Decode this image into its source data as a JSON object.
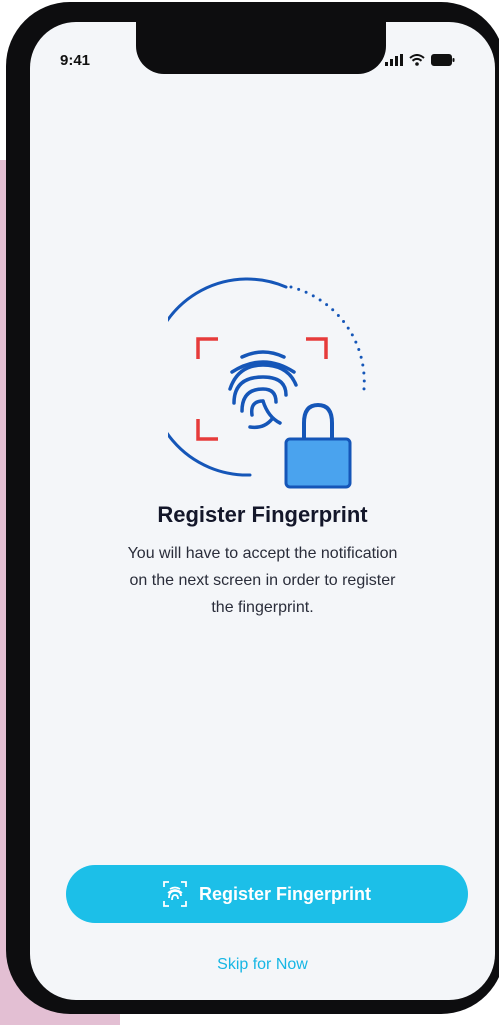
{
  "status_bar": {
    "time": "9:41",
    "signal_icon": "signal-bars-icon",
    "wifi_icon": "wifi-icon",
    "battery_icon": "battery-icon"
  },
  "illustration": {
    "name": "fingerprint-lock-illustration",
    "colors": {
      "arc": "#1556b8",
      "corners": "#e63b3b",
      "fingerprint": "#1556b8",
      "lock_body": "#4aa3ee"
    }
  },
  "content": {
    "title": "Register Fingerprint",
    "description": "You will have to accept the notification on the next screen in order to register the fingerprint."
  },
  "actions": {
    "primary_label": "Register Fingerprint",
    "primary_icon": "fingerprint-scan-icon",
    "secondary_label": "Skip for Now"
  },
  "colors": {
    "accent": "#1cbfe8",
    "link": "#16b6e4",
    "screen_bg": "#f4f6f9",
    "side_panel": "#e3bfd3"
  }
}
